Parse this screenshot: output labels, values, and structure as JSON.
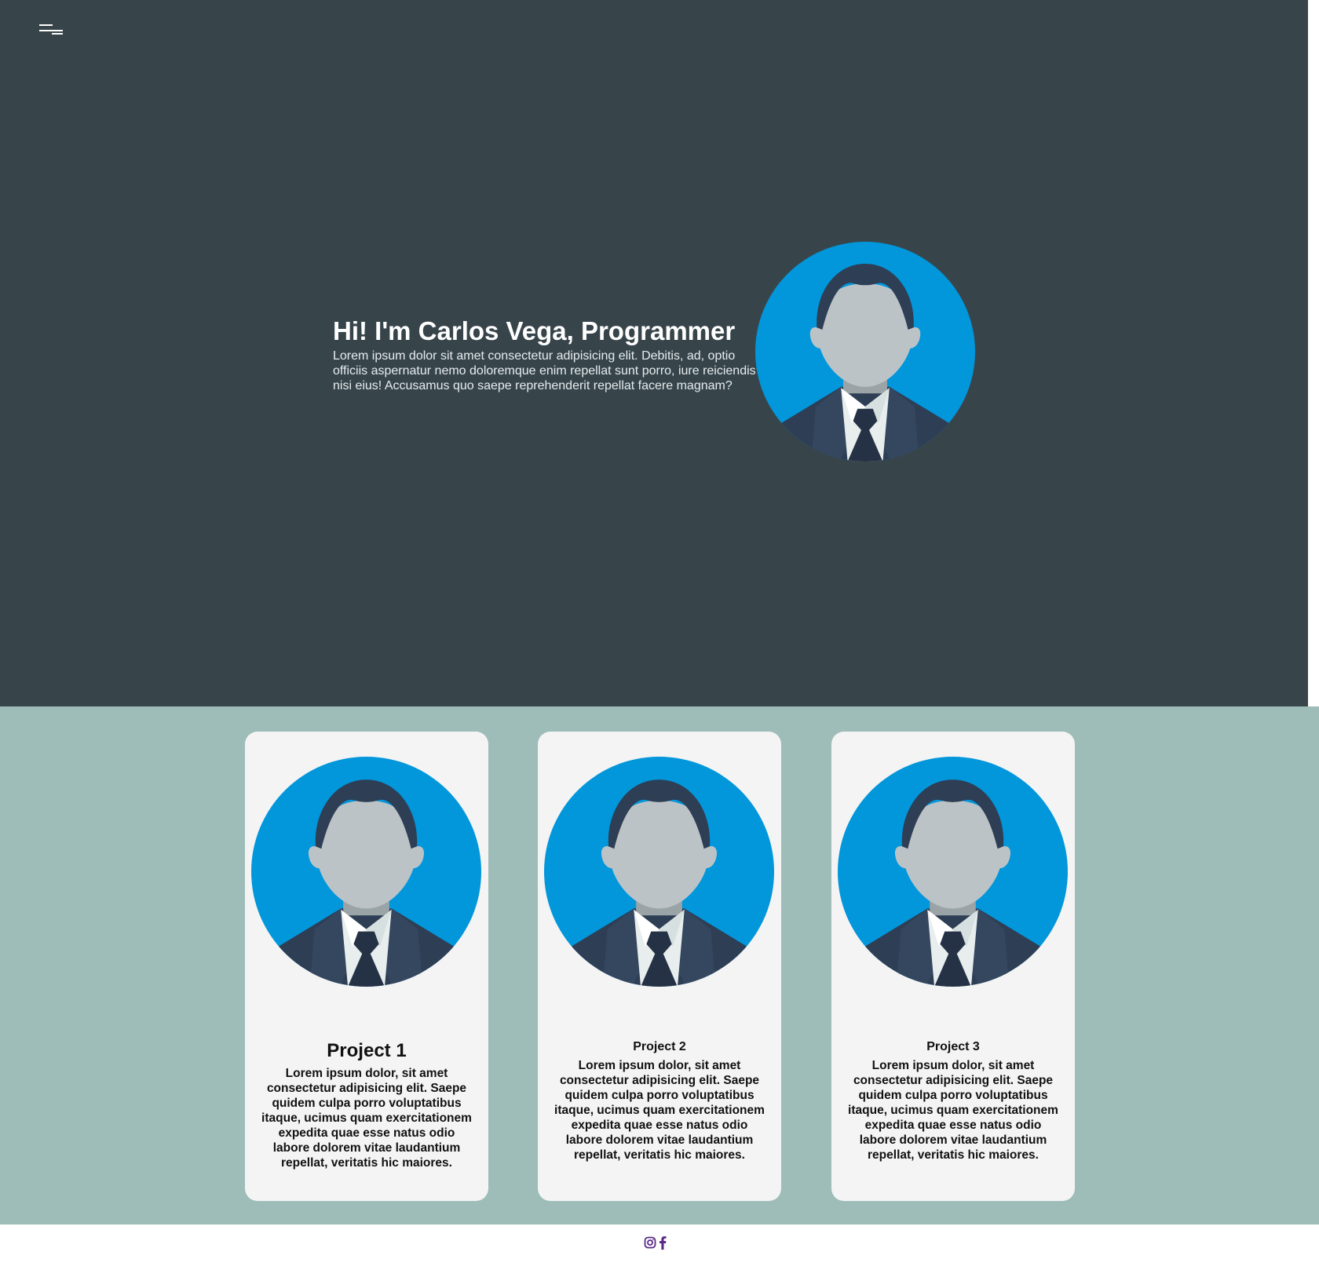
{
  "header": {
    "menu_icon": "menu-icon"
  },
  "hero": {
    "title": "Hi! I'm Carlos Vega, Programmer",
    "description": "Lorem ipsum dolor sit amet consectetur adipisicing elit. Debitis, ad, optio officiis aspernatur nemo doloremque enim repellat sunt porro, iure reiciendis nisi eius! Accusamus quo saepe reprehenderit repellat facere magnam?",
    "avatar_icon": "user-avatar-icon"
  },
  "projects": [
    {
      "title": "Project 1",
      "text": "Lorem ipsum dolor, sit amet consectetur adipisicing elit. Saepe quidem culpa porro voluptatibus itaque, ucimus quam exercitationem expedita quae esse natus odio labore dolorem vitae laudantium repellat, veritatis hic maiores."
    },
    {
      "title": "Project 2",
      "text": "Lorem ipsum dolor, sit amet consectetur adipisicing elit. Saepe quidem culpa porro voluptatibus itaque, ucimus quam exercitationem expedita quae esse natus odio labore dolorem vitae laudantium repellat, veritatis hic maiores."
    },
    {
      "title": "Project 3",
      "text": "Lorem ipsum dolor, sit amet consectetur adipisicing elit. Saepe quidem culpa porro voluptatibus itaque, ucimus quam exercitationem expedita quae esse natus odio labore dolorem vitae laudantium repellat, veritatis hic maiores."
    }
  ],
  "footer": {
    "icons": [
      "instagram-icon",
      "facebook-icon"
    ]
  },
  "colors": {
    "hero_bg": "#37454b",
    "projects_bg": "#9ebdb8",
    "card_bg": "#f4f4f4",
    "avatar_bg": "#0296db",
    "social_icon": "#5b2a86"
  }
}
